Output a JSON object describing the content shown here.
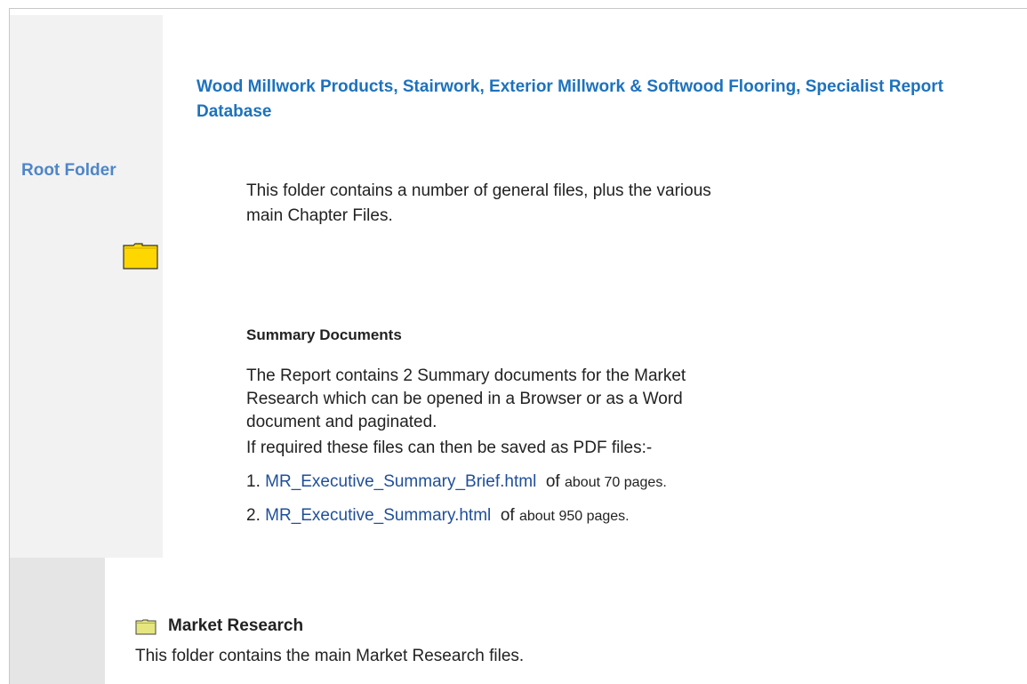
{
  "sidebar": {
    "root_label": "Root Folder"
  },
  "main": {
    "title": "Wood Millwork Products, Stairwork, Exterior Millwork & Softwood Flooring, Specialist Report Database",
    "intro": "This folder contains a number of general files, plus the various main Chapter Files.",
    "summary_heading": "Summary Documents",
    "summary_desc": "The Report contains 2 Summary documents for the Market Research which can be opened in a Browser or as a Word document and paginated.",
    "pdf_note": "If required these files can then be saved as PDF files:-",
    "documents": [
      {
        "number": "1.",
        "link": "MR_Executive_Summary_Brief.html",
        "of": "of",
        "pages": "about 70 pages."
      },
      {
        "number": "2.",
        "link": "MR_Executive_Summary.html",
        "of": "of",
        "pages": "about 950 pages."
      }
    ]
  },
  "subfolder": {
    "title": "Market Research",
    "desc": "This folder contains the main Market Research files."
  },
  "colors": {
    "title": "#1d72bd",
    "sidebar_label": "#4e86c8",
    "link": "#1f4f9a",
    "folder_yellow": "#ffd700",
    "folder_small": "#e6e680"
  },
  "icons": {
    "root": "folder-icon",
    "subfolder": "folder-icon"
  }
}
